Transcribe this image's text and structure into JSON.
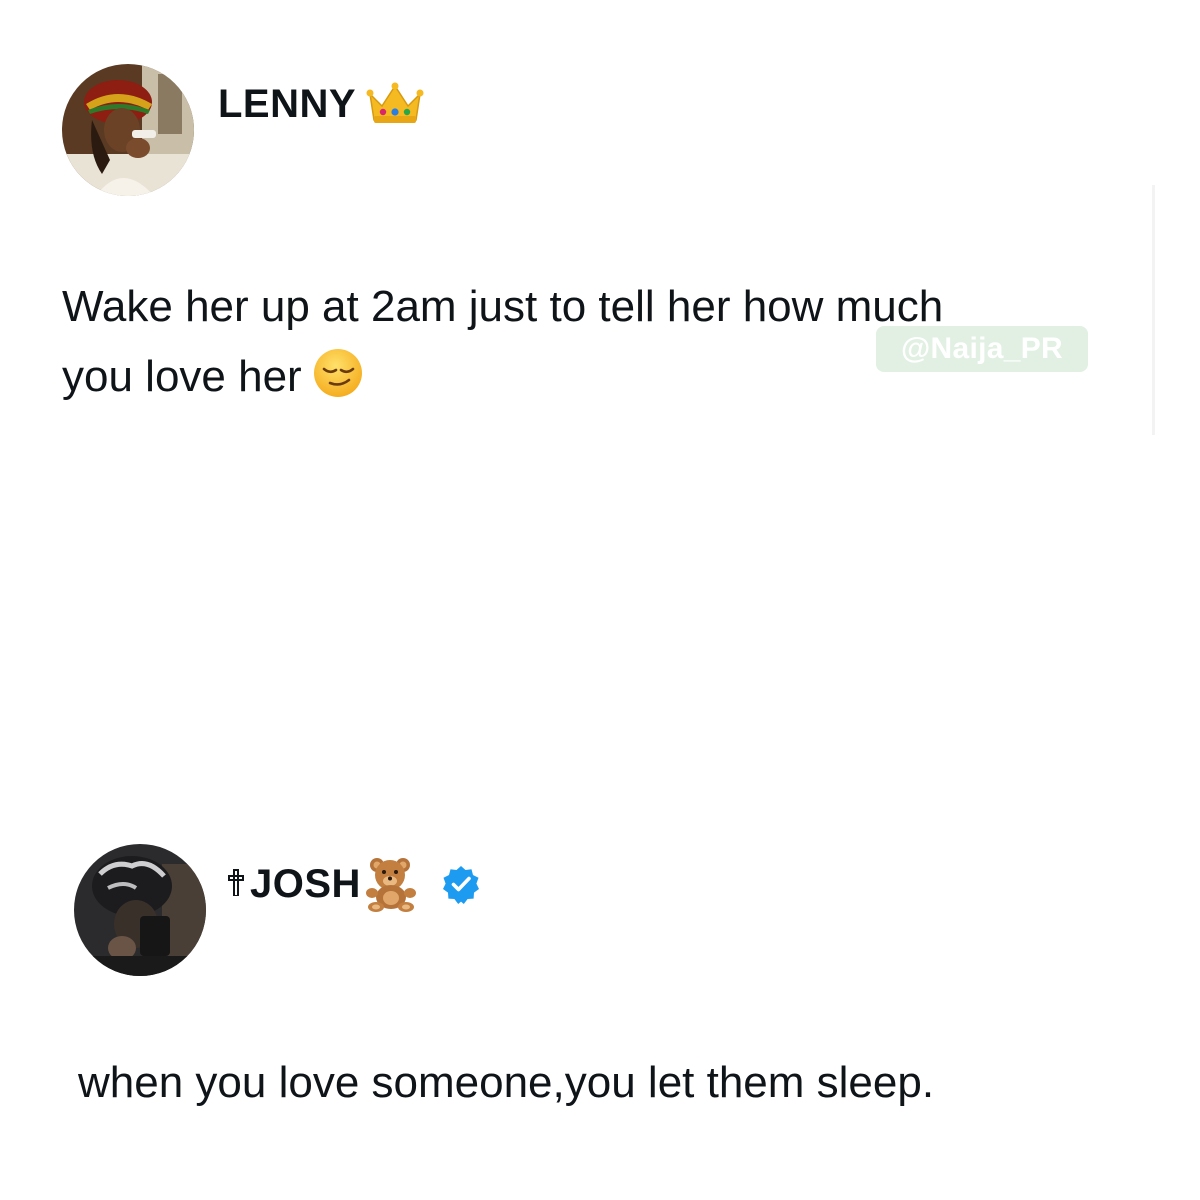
{
  "posts": [
    {
      "display_name": "LENNY",
      "name_emoji": "crown",
      "text_line1": "Wake her up at 2am just to tell her how much",
      "text_line2": "you love her",
      "text_emoji": "relieved-face",
      "avatar": "profile-photo"
    },
    {
      "name_prefix_icon": "latin-cross",
      "display_name": "JOSH",
      "name_emoji": "teddy-bear",
      "badge": "verified",
      "text": "when you love someone,you let them sleep.",
      "avatar": "profile-photo"
    }
  ],
  "watermark": "@Naija_PR",
  "colors": {
    "text": "#0f1419",
    "verified": "#1d9bf0",
    "watermark_bg": "#c8e4cc"
  }
}
